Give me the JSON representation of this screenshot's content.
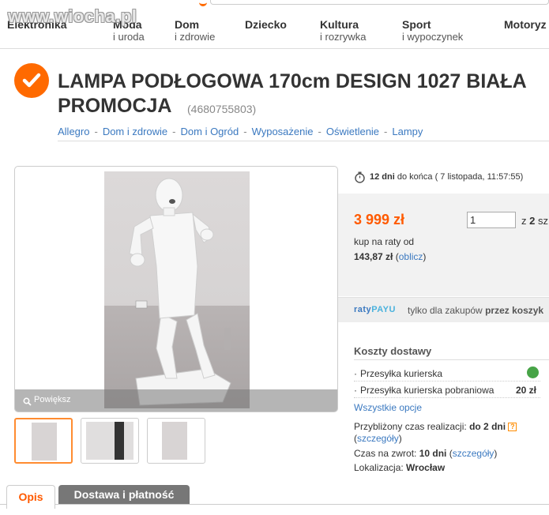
{
  "watermark": "www.wiocha.pl",
  "nav": {
    "items": [
      {
        "main": "Elektronika",
        "sub": ""
      },
      {
        "main": "Moda",
        "sub": "i uroda"
      },
      {
        "main": "Dom",
        "sub": "i zdrowie"
      },
      {
        "main": "Dziecko",
        "sub": ""
      },
      {
        "main": "Kultura",
        "sub": "i rozrywka"
      },
      {
        "main": "Sport",
        "sub": "i wypoczynek"
      },
      {
        "main": "Motoryz",
        "sub": ""
      }
    ]
  },
  "product": {
    "title_line1": "LAMPA PODŁOGOWA 170cm DESIGN 1027 BIAŁA",
    "title_line2": "PROMOCJA",
    "item_id": "(4680755803)"
  },
  "breadcrumb": [
    "Allegro",
    "Dom i zdrowie",
    "Dom i Ogród",
    "Wyposażenie",
    "Oświetlenie",
    "Lampy"
  ],
  "gallery": {
    "zoom_label": "Powiększ"
  },
  "timer": {
    "days": "12 dni",
    "suffix": "do końca",
    "end": "( 7 listopada, 11:57:55)"
  },
  "price": {
    "amount": "3 999 zł",
    "qty_value": "1",
    "qty_of_prefix": "z",
    "qty_of_value": "2",
    "qty_of_suffix": "sz",
    "raty_label": "kup na raty od",
    "raty_amount": "143,87 zł",
    "raty_link": "oblicz"
  },
  "raty_banner": {
    "logo_part1": "raty",
    "logo_part2": "PAYU",
    "text": "tylko dla zakupów",
    "text_bold": "przez koszyk"
  },
  "shipping": {
    "heading": "Koszty dostawy",
    "options": [
      {
        "name": "Przesyłka kurierska",
        "price": ""
      },
      {
        "name": "Przesyłka kurierska pobraniowa",
        "price": "20 zł"
      }
    ],
    "all_options": "Wszystkie opcje"
  },
  "details": {
    "realization_label": "Przybliżony czas realizacji:",
    "realization_value": "do 2 dni",
    "details_link": "szczegóły",
    "return_label": "Czas na zwrot:",
    "return_value": "10 dni",
    "location_label": "Lokalizacja:",
    "location_value": "Wrocław"
  },
  "tabs": [
    "Opis",
    "Dostawa i płatność"
  ],
  "colors": {
    "accent": "#ff6a00",
    "link": "#3b79c0"
  }
}
